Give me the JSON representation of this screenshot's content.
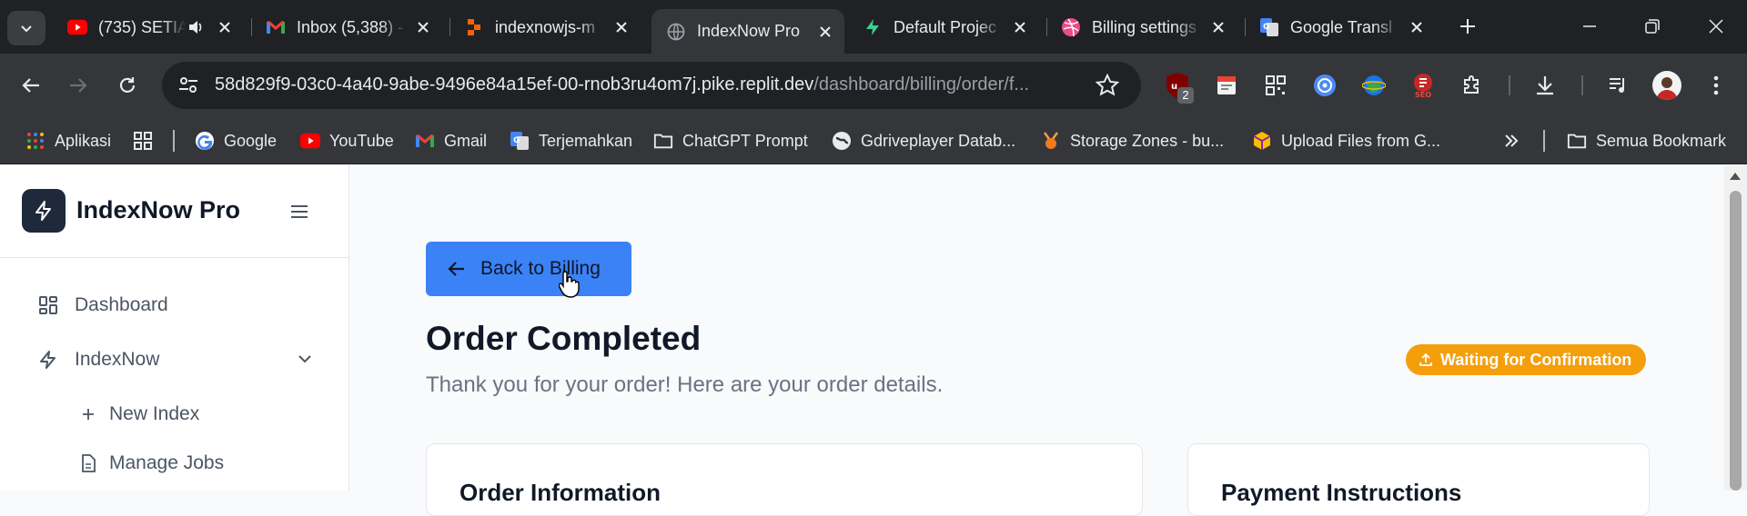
{
  "browser": {
    "tabs": [
      {
        "title": "(735) SETIA",
        "icon": "youtube-icon"
      },
      {
        "title": "Inbox (5,388) -",
        "icon": "gmail-icon"
      },
      {
        "title": "indexnowjs-m",
        "icon": "replit-icon"
      },
      {
        "title": "IndexNow Pro",
        "icon": "globe-icon",
        "active": true
      },
      {
        "title": "Default Projec",
        "icon": "supabase-icon"
      },
      {
        "title": "Billing settings",
        "icon": "dribbble-icon"
      },
      {
        "title": "Google Transl",
        "icon": "google-translate-icon"
      }
    ],
    "url_main": "58d829f9-03c0-4a40-9abe-9496e84a15ef-00-rnob3ru4om7j.pike.replit.dev",
    "url_path": "/dashboard/billing/order/f...",
    "extension_badge": "2",
    "bookmarks": [
      {
        "label": "Aplikasi",
        "icon": "apps-grid-icon"
      },
      {
        "label": "Google",
        "icon": "google-icon"
      },
      {
        "label": "YouTube",
        "icon": "youtube-icon"
      },
      {
        "label": "Gmail",
        "icon": "gmail-icon"
      },
      {
        "label": "Terjemahkan",
        "icon": "google-translate-icon"
      },
      {
        "label": "ChatGPT Prompt",
        "icon": "folder-icon"
      },
      {
        "label": "Gdriveplayer Datab...",
        "icon": "globe-icon"
      },
      {
        "label": "Storage Zones - bu...",
        "icon": "bunny-icon"
      },
      {
        "label": "Upload Files from G...",
        "icon": "box-icon"
      }
    ],
    "all_bookmarks": "Semua Bookmark"
  },
  "app": {
    "brand": "IndexNow Pro",
    "nav": [
      {
        "label": "Dashboard",
        "icon": "dashboard-icon"
      },
      {
        "label": "IndexNow",
        "icon": "bolt-icon"
      },
      {
        "label": "New Index",
        "icon": "plus-icon"
      },
      {
        "label": "Manage Jobs",
        "icon": "file-icon"
      }
    ],
    "back_label": "Back to Billing",
    "title": "Order Completed",
    "subtitle": "Thank you for your order! Here are your order details.",
    "status": "Waiting for Confirmation",
    "card_order_title": "Order Information",
    "card_payment_title": "Payment Instructions"
  },
  "colors": {
    "accent": "#3b82f6",
    "status": "#f59e0b",
    "brand_dark": "#1e293b"
  }
}
